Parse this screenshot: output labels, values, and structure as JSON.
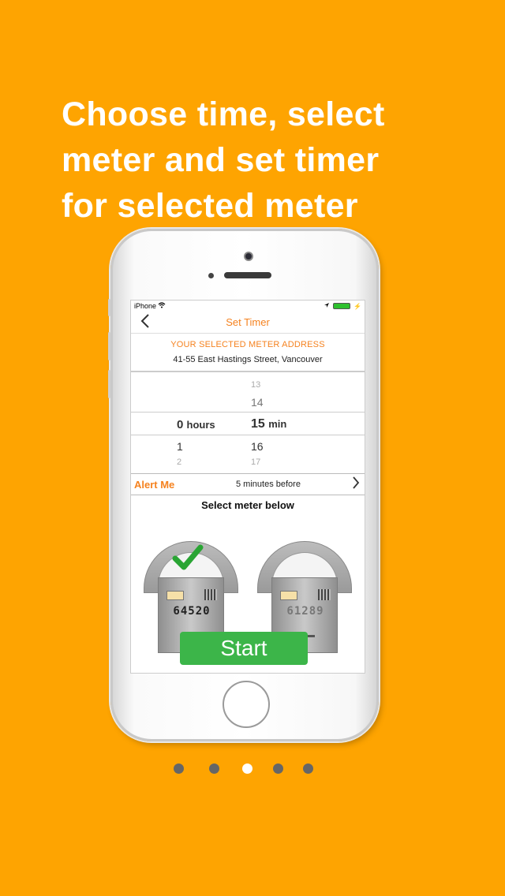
{
  "headline": [
    "Choose time, select",
    "meter and set timer",
    "for selected meter"
  ],
  "status": {
    "carrier": "iPhone",
    "battery_color": "#2ec02e"
  },
  "nav": {
    "back_icon": "chevron-left-icon",
    "title": "Set Timer"
  },
  "address": {
    "heading": "YOUR SELECTED METER ADDRESS",
    "value": "41-55 East Hastings Street, Vancouver"
  },
  "picker": {
    "hours": {
      "selected": "0",
      "unit": "hours",
      "below": [
        "1",
        "2"
      ]
    },
    "minutes": {
      "above": [
        "13",
        "14"
      ],
      "selected": "15",
      "unit": "min",
      "below": [
        "16",
        "17"
      ]
    }
  },
  "alert": {
    "label": "Alert Me",
    "value": "5 minutes before"
  },
  "meters": {
    "label": "Select meter below",
    "items": [
      {
        "number": "64520",
        "selected": true
      },
      {
        "number": "61289",
        "selected": false
      }
    ]
  },
  "start_label": "Start",
  "pagination": {
    "count": 5,
    "active_index": 2
  },
  "colors": {
    "background": "#FEA401",
    "accent": "#F5821F",
    "start": "#3CB549"
  }
}
